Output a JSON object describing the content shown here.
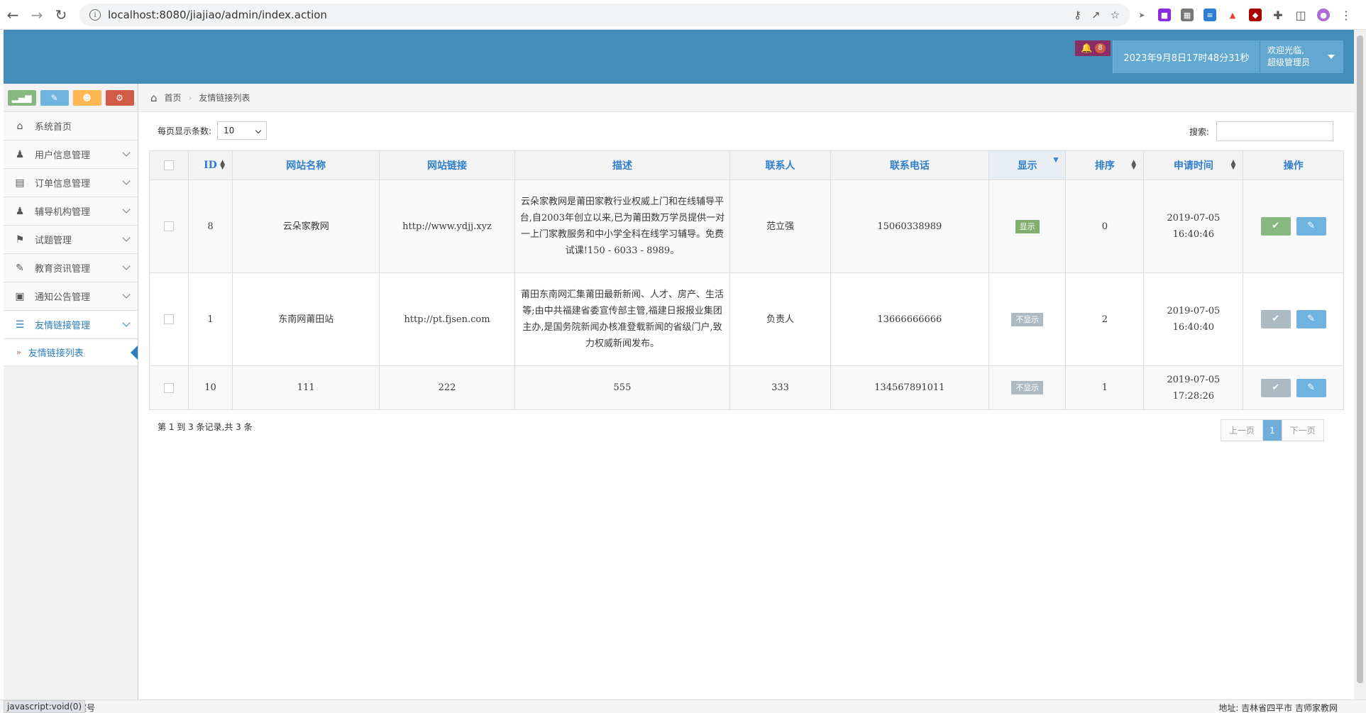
{
  "browser": {
    "url": "localhost:8080/jiajiao/admin/index.action"
  },
  "header": {
    "notification_count": "8",
    "datetime": "2023年9月8日17时48分31秒",
    "welcome": "欢迎光临,",
    "role": "超级管理员"
  },
  "sidebar": {
    "items": [
      {
        "label": "系统首页",
        "icon": "home-icon"
      },
      {
        "label": "用户信息管理",
        "icon": "user-icon"
      },
      {
        "label": "订单信息管理",
        "icon": "credit-card-icon"
      },
      {
        "label": "辅导机构管理",
        "icon": "user-icon"
      },
      {
        "label": "试题管理",
        "icon": "bookmark-icon"
      },
      {
        "label": "教育资讯管理",
        "icon": "comments-icon"
      },
      {
        "label": "通知公告管理",
        "icon": "desktop-icon"
      },
      {
        "label": "友情链接管理",
        "icon": "list-icon"
      }
    ],
    "sub_item": "友情链接列表"
  },
  "breadcrumb": {
    "home": "首页",
    "current": "友情链接列表"
  },
  "controls": {
    "page_size_label": "每页显示条数:",
    "page_size_value": "10",
    "search_label": "搜索:"
  },
  "table": {
    "headers": [
      "ID",
      "网站名称",
      "网站链接",
      "描述",
      "联系人",
      "联系电话",
      "显示",
      "排序",
      "申请时间",
      "操作"
    ],
    "rows": [
      {
        "id": "8",
        "name": "云朵家教网",
        "url": "http://www.ydjj.xyz",
        "desc": "云朵家教网是莆田家教行业权威上门和在线辅导平台,自2003年创立以来,已为莆田数万学员提供一对一上门家教服务和中小学全科在线学习辅导。免费试课!150 - 6033 - 8989。",
        "contact": "范立强",
        "phone": "15060338989",
        "show": "显示",
        "order": "0",
        "time": "2019-07-05 16:40:46"
      },
      {
        "id": "1",
        "name": "东南网莆田站",
        "url": "http://pt.fjsen.com",
        "desc": "莆田东南网汇集莆田最新新闻、人才、房产、生活等;由中共福建省委宣传部主管,福建日报报业集团主办,是国务院新闻办核准登载新闻的省级门户,致力权威新闻发布。",
        "contact": "负责人",
        "phone": "13666666666",
        "show": "不显示",
        "order": "2",
        "time": "2019-07-05 16:40:40"
      },
      {
        "id": "10",
        "name": "111",
        "url": "222",
        "desc": "555",
        "contact": "333",
        "phone": "134567891011",
        "show": "不显示",
        "order": "1",
        "time": "2019-07-05 17:28:26"
      }
    ]
  },
  "pagination": {
    "info": "第 1 到 3 条记录,共 3 条",
    "prev": "上一页",
    "current": "1",
    "next": "下一页"
  },
  "statusbar": {
    "tip": "javascript:void(0)",
    "left_fragment": "案号",
    "right_text": "地址: 吉林省四平市 吉师家教网"
  }
}
